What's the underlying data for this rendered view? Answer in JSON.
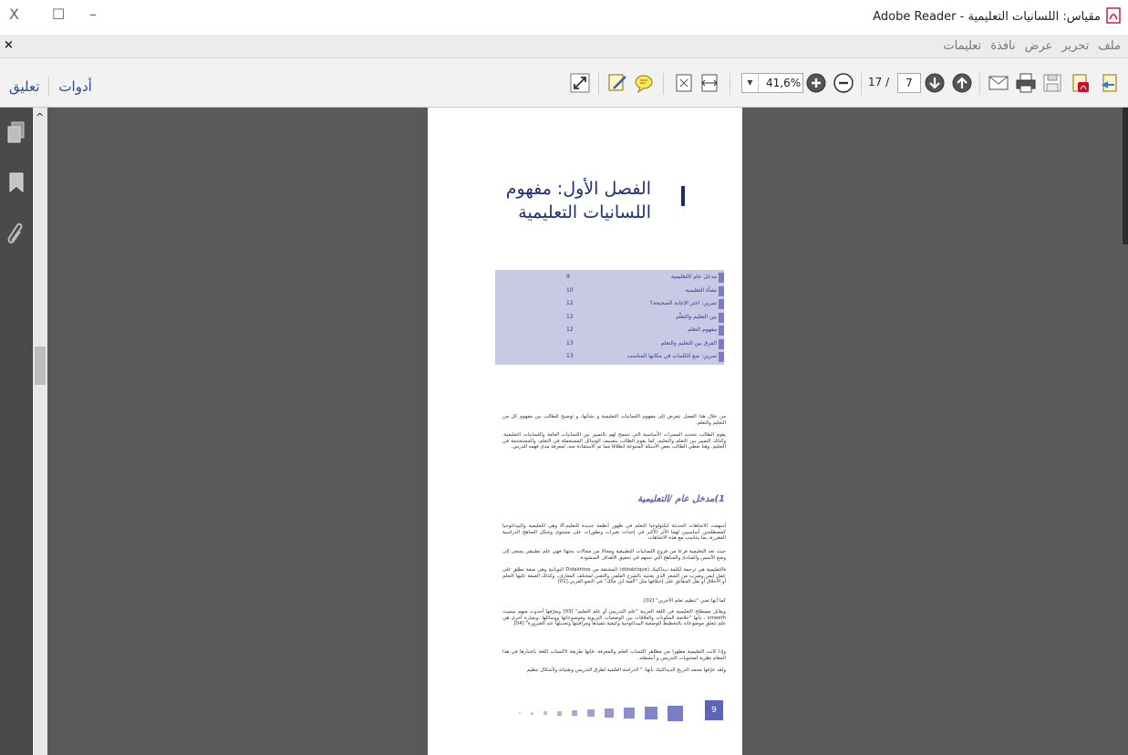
{
  "window": {
    "title": "مقياس: اللسانيات التعليمية - Adobe Reader",
    "close_symbol": "X",
    "restore_symbol": "☐",
    "minimize_symbol": "–"
  },
  "menubar": {
    "close_symbol": "×",
    "items": [
      "ملف",
      "تحرير",
      "عرض",
      "نافذة",
      "تعليمات"
    ]
  },
  "toolbar": {
    "comment_label": "تعليق",
    "tools_label": "أدوات",
    "zoom_value": "41,6%",
    "zoom_dropdown_symbol": "▼",
    "page_current": "7",
    "page_total": "17 /"
  },
  "document": {
    "chapter_title": "الفصل الأول: مفهوم اللسانيات التعليمية",
    "toc": [
      {
        "title": "مدخل عام /التعليمية",
        "page": "9"
      },
      {
        "title": "نشأة التعليمية",
        "page": "10"
      },
      {
        "title": "تمرين: اختر الإجابة الصحيحة؟",
        "page": "12"
      },
      {
        "title": "بين التعليم والتعلّم",
        "page": "12"
      },
      {
        "title": "مفهوم التعلم",
        "page": "12"
      },
      {
        "title": "الفرق بين التعليم والتعلم",
        "page": "13"
      },
      {
        "title": "تمرين: ضع الكلمات في مكانها المناسب",
        "page": "13"
      }
    ],
    "intro_p1": "من خلال هذا الفصل نتعرض إلى مفهوم اللسانيات التعليمية و نشأتها، و توضيح للطالب بين مفهوم كل من التعليم والتعلم.",
    "intro_p2": "يقوم الطالب بتحديد المميزات الأساسية التي تسمح لهم بالتمييز بين اللسانيات العامة واللسانيات التعليمية، وكذلك التمييز بين التعلم والتعليم، كما يقوم الطالب بتصنيف الوسائل المستعملة في التعلم، والمستخدمة في التعليم، وهنا نعطي الطالب بعض الأسئلة المتنوعة انطلاقا مما تم الاستفادة منه، لمعرفة مدى فهمه للدرس.",
    "section_heading": "1)مدخل عام /التعليمية",
    "body_p1": "أسهمت الاتجاهات الحديثة لتكنولوجيا التعلم في ظهور أنظمة جديدة للتعليم،ألا وهي التعليمية والبيداغوجيا كمصطلحين أساسيين لهما الأثر الأكبر في إحداث تغيرات وتطورات على مستوى وشكل المناهج الدراسية المقررة، بما يتناسب مع هذه الاتجاهات.",
    "body_p2": "حيث تعد التعليمية فرعا من فروع اللسانيات التطبيقية ومجالا من مجالات بحثها؛ فهي علم تطبيقي يسعى إلى وضع الأسس والمبادئ والمناهج التي تسهم في تحقيق الأهداف المنشودة.",
    "body_p3": "فالتعليمية هي ترجمة لكلمة ديداكتيك (didaktique) المشتقة من Didaktitos اليونانية وهي صفة تطلق على عمل أيمن وضرب من الشعر الذي يعتنيه بالشرح العلمي والتقني لمختلف المعارف، وكذلك الصفة عليها التعلم أو الأخلاق أو نقل الحقائق على إختلافها مثل \"ألفية ابن مالك\" في النحو العربي.[01]",
    "body_p4": "كما أنها تعني \"تنظيم تعلم الآخرين\" [02].",
    "body_p5": "ويقابل مصطلح التعليمية في اللغة العربية \"علم التدريس أو علم التعليم\" [03] ويعرّفها أحدوت منهم سميث smeeth ، بأنها \"خلاصة المكونات والعلاقات بين الوضعيات التربوية وموضوعاتها ووسائلها ،وبعبارة أخرى هي علم تتعلق موضوعاته بالتخطيط للوضعية البيداغوجية وكيفية تنفيذها ومراقبتها وتعديلها عند الضرورة\" [04]",
    "body_p6": "وإذا كانت التعليمية مظهرا من مظاهر اكتساب العلم والمعرفة ،فإنها طريقة لاكتساب اللغة باعتبارها في هذا المقام نظرية لمحتويات التدريس و أنشطته.",
    "body_p7": "ولقد عرّفها محمد الدريج الديداكتيك بأنها: \" الدراسة العلمية لطرق التدريس وتقنياته ولأشكال تنظيم",
    "page_number": "9"
  }
}
